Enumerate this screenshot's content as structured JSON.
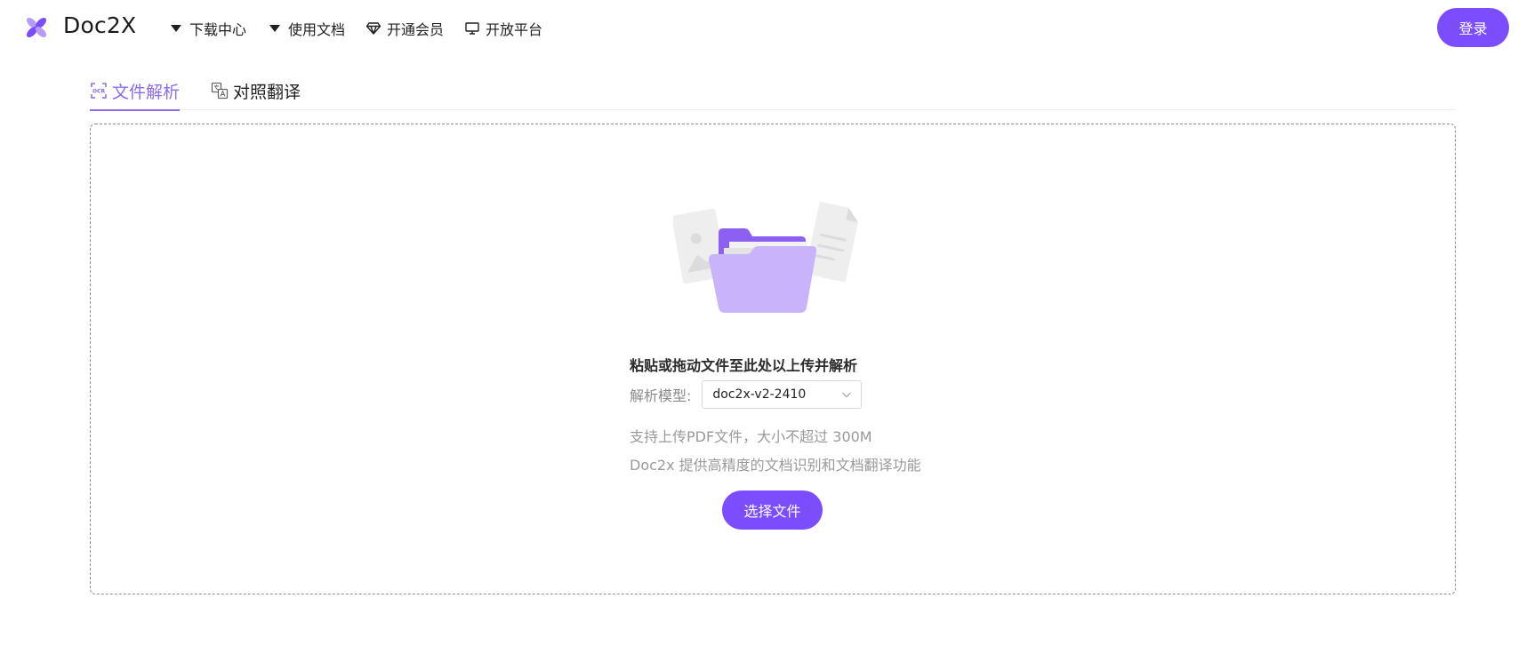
{
  "header": {
    "brand": "Doc2X",
    "nav": [
      {
        "label": "下载中心",
        "icon": "caret-down-icon"
      },
      {
        "label": "使用文档",
        "icon": "caret-down-icon"
      },
      {
        "label": "开通会员",
        "icon": "diamond-icon"
      },
      {
        "label": "开放平台",
        "icon": "monitor-icon"
      }
    ],
    "login_label": "登录"
  },
  "tabs": [
    {
      "label": "文件解析",
      "icon": "ocr-scan-icon",
      "active": true
    },
    {
      "label": "对照翻译",
      "icon": "translate-icon",
      "active": false
    }
  ],
  "dropzone": {
    "title": "粘贴或拖动文件至此处以上传并解析",
    "model_label": "解析模型:",
    "model_value": "doc2x-v2-2410",
    "hint_size": "支持上传PDF文件，大小不超过 300M",
    "hint_desc": "Doc2x 提供高精度的文档识别和文档翻译功能",
    "choose_label": "选择文件"
  },
  "colors": {
    "accent": "#7c4dff",
    "tab_active": "#8c6bef",
    "folder": "#c9b3fb"
  }
}
